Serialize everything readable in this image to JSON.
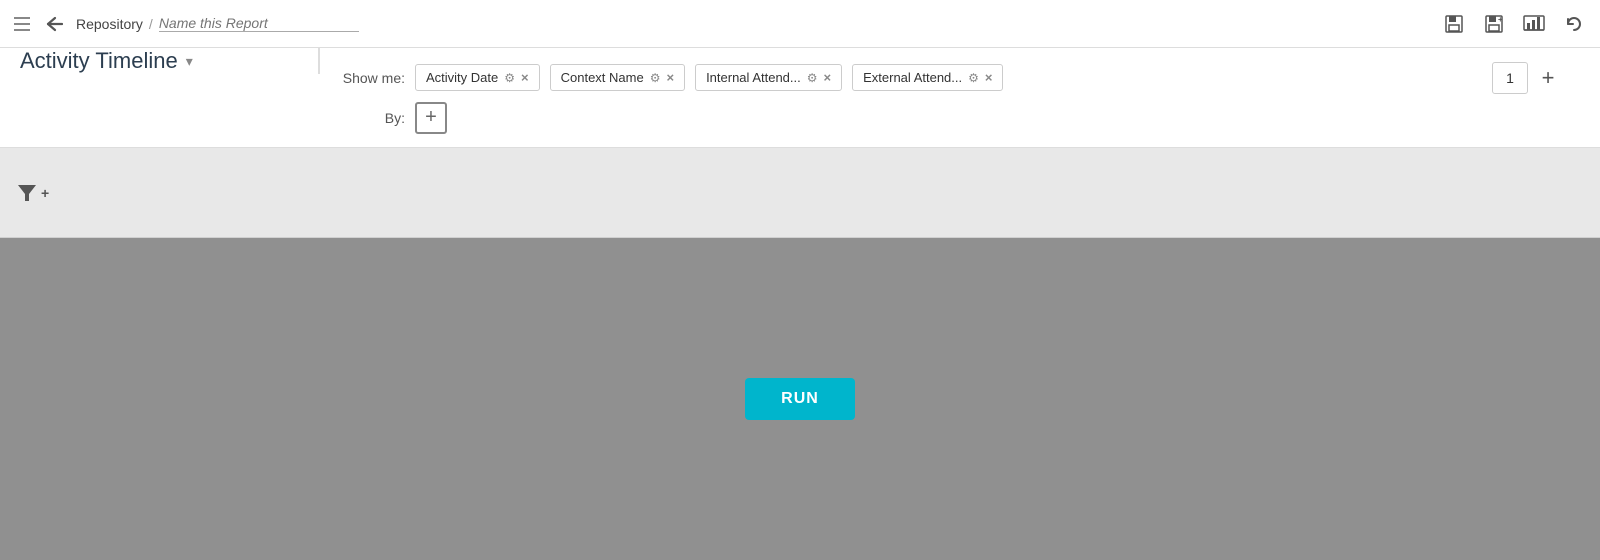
{
  "navbar": {
    "back_label": "←",
    "breadcrumb_repo": "Repository",
    "breadcrumb_sep": "/",
    "breadcrumb_placeholder": "Name this Report",
    "save_icon": "💾",
    "save_as_icon": "💾",
    "chart_icon": "📊",
    "undo_icon": "↩"
  },
  "controls": {
    "show_label": "Show me:",
    "by_label": "By:",
    "report_type": "Activity Timeline",
    "fields": [
      {
        "id": "activity-date",
        "label": "Activity Date"
      },
      {
        "id": "context-name",
        "label": "Context Name"
      },
      {
        "id": "internal-attend",
        "label": "Internal Attend..."
      },
      {
        "id": "external-attend",
        "label": "External Attend..."
      }
    ],
    "page_number": "1",
    "add_field_label": "+"
  },
  "filter": {
    "icon_label": "▼+",
    "area_placeholder": ""
  },
  "main": {
    "run_button_label": "RUN"
  }
}
